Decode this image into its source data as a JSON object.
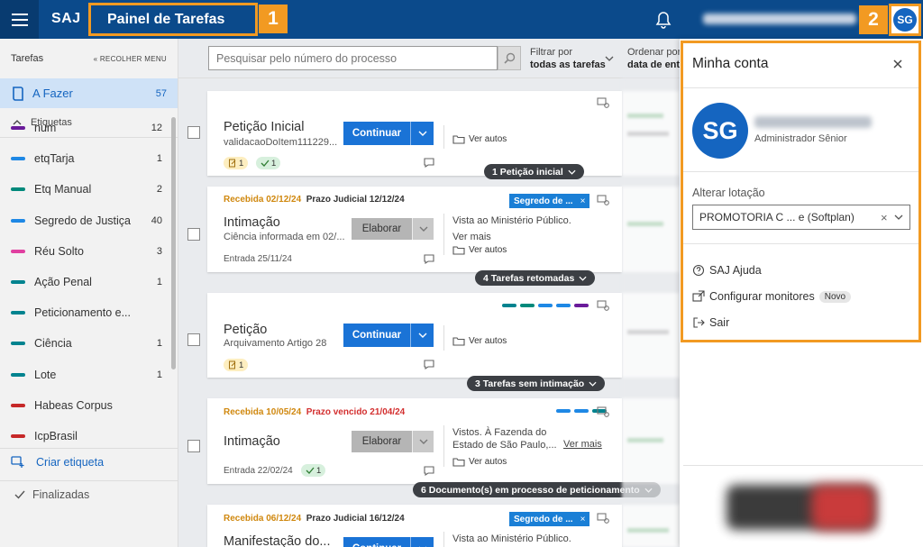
{
  "topbar": {
    "logo": "SAJ",
    "title": "Painel de Tarefas",
    "badge1": "1",
    "badge2": "2",
    "user_initials": "SG"
  },
  "sidebar": {
    "header": "Tarefas",
    "collapse": "RECOLHER MENU",
    "afazer": {
      "label": "A Fazer",
      "count": "57"
    },
    "etiquetas_label": "Etiquetas",
    "items": [
      {
        "label": "num",
        "count": "12",
        "color": "#6a1b9a"
      },
      {
        "label": "etqTarja",
        "count": "1",
        "color": "#1e88e5"
      },
      {
        "label": "Etq Manual",
        "count": "2",
        "color": "#00897b"
      },
      {
        "label": "Segredo de Justiça",
        "count": "40",
        "color": "#1e88e5"
      },
      {
        "label": "Réu Solto",
        "count": "3",
        "color": "#e040a0"
      },
      {
        "label": "Ação Penal",
        "count": "1",
        "color": "#00838f"
      },
      {
        "label": "Peticionamento e...",
        "count": "",
        "color": "#00838f"
      },
      {
        "label": "Ciência",
        "count": "1",
        "color": "#00838f"
      },
      {
        "label": "Lote",
        "count": "1",
        "color": "#00838f"
      },
      {
        "label": "Habeas Corpus",
        "count": "",
        "color": "#c62828"
      },
      {
        "label": "IcpBrasil",
        "count": "",
        "color": "#c62828"
      }
    ],
    "criar": "Criar etiqueta",
    "finalizadas": "Finalizadas"
  },
  "toolbar": {
    "search_placeholder": "Pesquisar pelo número do processo",
    "filter_label": "Filtrar por",
    "filter_value": "todas as tarefas",
    "order_label": "Ordenar por",
    "order_value": "data de ent"
  },
  "cards": [
    {
      "title": "Petição Inicial",
      "sub": "validacaoDoItem111229...",
      "action": "Continuar",
      "right": "",
      "verautos": "Ver autos",
      "chip1": "1",
      "chip2": "1",
      "group": "1 Petição inicial"
    },
    {
      "received": "Recebida 02/12/24",
      "prazo": "Prazo Judicial 12/12/24",
      "segredo": "Segredo de ...",
      "title": "Intimação",
      "sub": "Ciência informada em 02/...",
      "action": "Elaborar",
      "right1": "Vista ao Ministério Público.",
      "right2": "Ver mais",
      "verautos": "Ver autos",
      "entrada": "Entrada 25/11/24",
      "group": "4 Tarefas retomadas"
    },
    {
      "title": "Petição",
      "sub": "Arquivamento Artigo 28",
      "action": "Continuar",
      "verautos": "Ver autos",
      "chip1": "1",
      "group": "3 Tarefas sem intimação"
    },
    {
      "received": "Recebida 10/05/24",
      "prazo": "Prazo vencido 21/04/24",
      "title": "Intimação",
      "action": "Elaborar",
      "right1": "Vistos. À Fazenda do",
      "right2": "Estado de São Paulo,...",
      "vermais": "Ver mais",
      "verautos": "Ver autos",
      "entrada": "Entrada 22/02/24",
      "chip2": "1",
      "group": "6 Documento(s) em processo de peticionamento"
    },
    {
      "received": "Recebida 06/12/24",
      "prazo": "Prazo Judicial 16/12/24",
      "segredo": "Segredo de ...",
      "title": "Manifestação do...",
      "action": "Continuar",
      "right1": "Vista ao Ministério Público."
    }
  ],
  "panel": {
    "title": "Minha conta",
    "initials": "SG",
    "role": "Administrador Sênior",
    "lotacao_label": "Alterar lotação",
    "lotacao_value": "PROMOTORIA C ... e (Softplan)",
    "ajuda": "SAJ Ajuda",
    "monitores": "Configurar monitores",
    "novo": "Novo",
    "sair": "Sair"
  }
}
